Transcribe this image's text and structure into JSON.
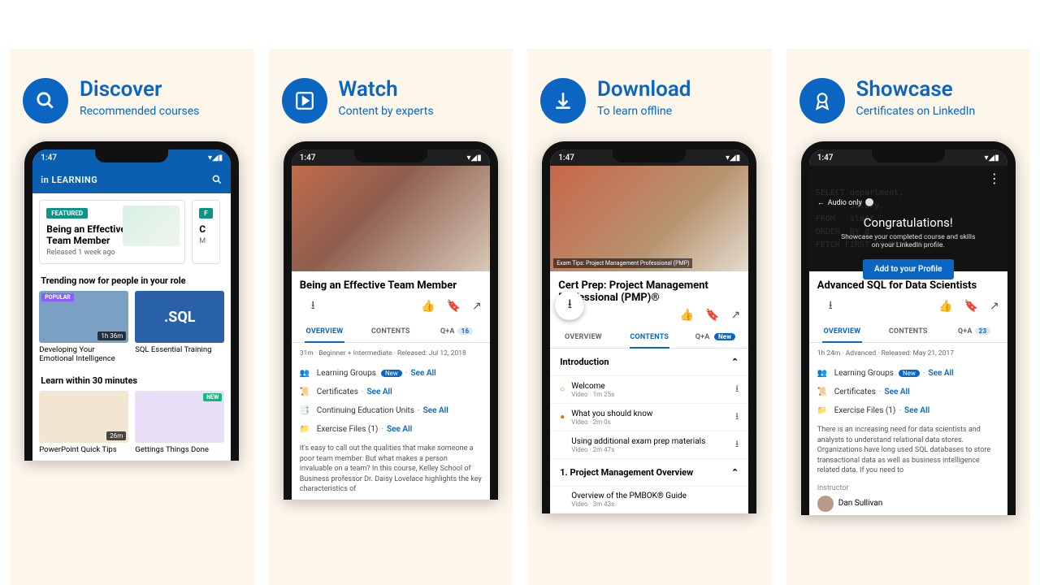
{
  "panels": [
    {
      "title": "Discover",
      "subtitle": "Recommended courses",
      "icon": "search"
    },
    {
      "title": "Watch",
      "subtitle": "Content by experts",
      "icon": "play-box"
    },
    {
      "title": "Download",
      "subtitle": "To learn offline",
      "icon": "download"
    },
    {
      "title": "Showcase",
      "subtitle": "Certificates on LinkedIn",
      "icon": "ribbon"
    }
  ],
  "status_time": "1:47",
  "p1": {
    "brand": "LEARNING",
    "featured": {
      "tag": "FEATURED",
      "title": "Being an Effective Team Member",
      "released": "Released 1 week ago",
      "peek_title": "C",
      "peek_line": "M"
    },
    "section1": "Trending now for people in your role",
    "trend": [
      {
        "title": "Developing Your Emotional Intelligence",
        "dur": "1h 36m",
        "pop": "POPULAR"
      },
      {
        "title": "SQL Essential Training",
        "sql": ".SQL"
      }
    ],
    "section2": "Learn within 30 minutes",
    "learn": [
      {
        "title": "PowerPoint Quick Tips",
        "dur": "26m"
      },
      {
        "title": "Gettings Things Done",
        "new": "NEW"
      }
    ]
  },
  "p2": {
    "title": "Being an Effective Team Member",
    "tabs": {
      "overview": "OVERVIEW",
      "contents": "CONTENTS",
      "qa": "Q+A",
      "qa_count": "16"
    },
    "meta": "31m · Beginner + Intermediate · Released: Jul 12, 2018",
    "rows": {
      "groups": "Learning Groups",
      "groups_badge": "New",
      "see_all": "See All",
      "certs": "Certificates",
      "ceu": "Continuing Education Units",
      "files": "Exercise Files (1)"
    },
    "desc": "It's easy to call out the qualities that make someone a poor team member. But what makes a person invaluable on a team? In this course, Kelley School of Business professor Dr. Daisy Lovelace highlights the key characteristics of"
  },
  "p3": {
    "title": "Cert Prep: Project Management Professional (PMP)®",
    "caption": "Exam Tips: Project Management Professional (PMP)",
    "tabs": {
      "overview": "OVERVIEW",
      "contents": "CONTENTS",
      "qa": "Q+A",
      "qa_badge": "New"
    },
    "intro": "Introduction",
    "lessons": [
      {
        "title": "Welcome",
        "meta": "Video · 1m 25s",
        "bullet": true
      },
      {
        "title": "What you should know",
        "meta": "Video · 2m 0s",
        "bullet": true
      },
      {
        "title": "Using additional exam prep materials",
        "meta": "Video · 2m 47s"
      }
    ],
    "section": "1. Project Management Overview",
    "lesson4": {
      "title": "Overview of the PMBOK® Guide",
      "meta": "Video · 3m 43s"
    }
  },
  "p4": {
    "audio": "Audio only",
    "congrats": "Congratulations!",
    "congrats_sub": "Showcase your completed course and skills on your LinkedIn profile.",
    "btn": "Add to your Profile",
    "code": "SELECT department,\n       salary,\nFROM   staff\nORDER  BY d\nFETCH FIRST 10 ROWS ONLY;",
    "title": "Advanced SQL for Data Scientists",
    "tabs": {
      "overview": "OVERVIEW",
      "contents": "CONTENTS",
      "qa": "Q+A",
      "qa_count": "23"
    },
    "meta": "1h 24m · Advanced · Released: May 21, 2017",
    "rows": {
      "groups": "Learning Groups",
      "groups_badge": "New",
      "see_all": "See All",
      "certs": "Certificates",
      "files": "Exercise Files (1)"
    },
    "desc": "There is an increasing need for data scientists and analysts to understand relational data stores. Organizations have long used SQL databases to store transactional data as well as business intelligence related data. If you need to",
    "instructor_label": "Instructor",
    "instructor": "Dan Sullivan"
  }
}
